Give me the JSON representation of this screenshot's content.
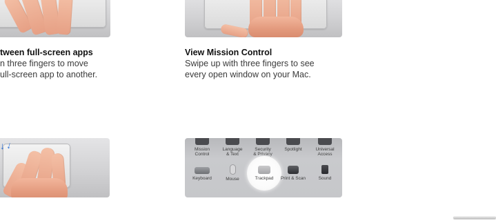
{
  "sections": {
    "fullscreen": {
      "heading": "tween full-screen apps",
      "line1": "n three fingers to move",
      "line2": "ull-screen app to another."
    },
    "mission_control": {
      "heading": "View Mission Control",
      "line1": "Swipe up with three fingers to see",
      "line2": "every open window on your Mac."
    }
  },
  "preferences": {
    "top_row": [
      {
        "line1": "Mission",
        "line2": "Control",
        "icon": "mission-control-icon"
      },
      {
        "line1": "Language",
        "line2": "& Text",
        "icon": "language-icon"
      },
      {
        "line1": "Security",
        "line2": "& Privacy",
        "icon": "security-icon"
      },
      {
        "line1": "Spotlight",
        "line2": "",
        "icon": "spotlight-icon"
      },
      {
        "line1": "Universal",
        "line2": "Access",
        "icon": "universal-access-icon"
      }
    ],
    "middle_row": [
      {
        "label": "Keyboard",
        "icon": "keyboard-icon"
      },
      {
        "label": "Mouse",
        "icon": "mouse-icon"
      },
      {
        "label": "Trackpad",
        "icon": "trackpad-icon"
      },
      {
        "label": "Print & Scan",
        "icon": "printer-icon"
      },
      {
        "label": "Sound",
        "icon": "speaker-icon"
      }
    ]
  }
}
